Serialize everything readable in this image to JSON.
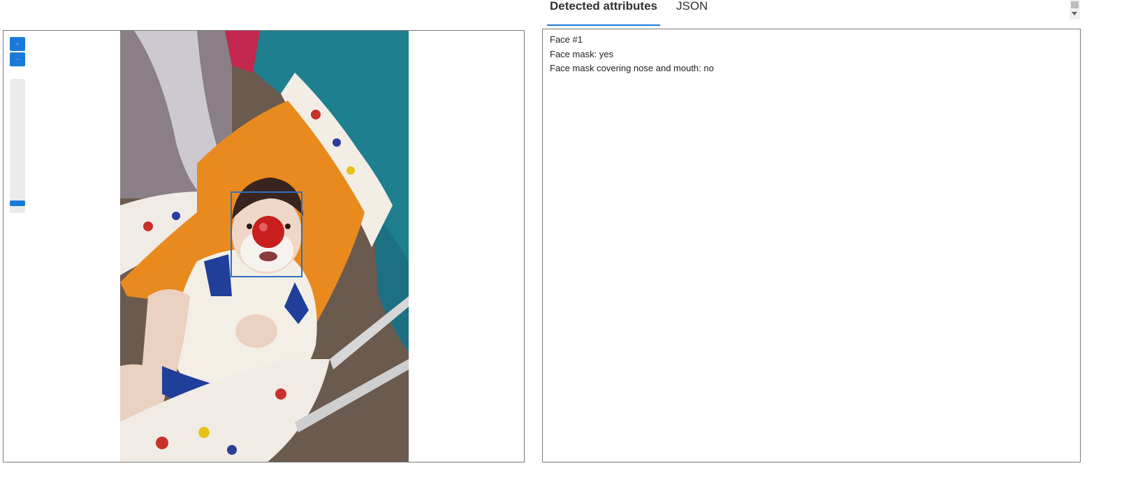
{
  "tabs": [
    {
      "label": "Detected attributes",
      "active": true
    },
    {
      "label": "JSON",
      "active": false
    }
  ],
  "zoom_controls": {
    "zoom_in_icon": "plus-icon",
    "zoom_out_icon": "minus-icon",
    "zoom_level_fraction": 0.05
  },
  "photo": {
    "description_icon": "baby-in-stroller-photo",
    "face_box_color": "#2f6fbf"
  },
  "results": {
    "lines": [
      "Face #1",
      "Face mask: yes",
      "Face mask covering nose and mouth: no"
    ]
  },
  "colors": {
    "accent": "#1a7bd6",
    "border": "#7a7a7a"
  }
}
